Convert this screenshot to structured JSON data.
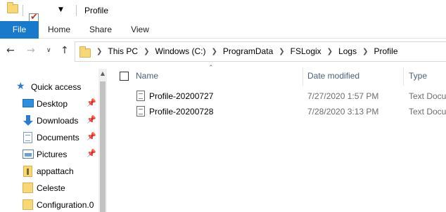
{
  "window": {
    "title": "Profile"
  },
  "ribbon": {
    "tabs": [
      "File",
      "Home",
      "Share",
      "View"
    ]
  },
  "address": {
    "crumbs": [
      "This PC",
      "Windows (C:)",
      "ProgramData",
      "FSLogix",
      "Logs",
      "Profile"
    ]
  },
  "nav_pane": {
    "quick_access_label": "Quick access",
    "items": [
      {
        "label": "Desktop",
        "icon": "desktop-icon",
        "pinned": true
      },
      {
        "label": "Downloads",
        "icon": "downloads-icon",
        "pinned": true
      },
      {
        "label": "Documents",
        "icon": "documents-icon",
        "pinned": true
      },
      {
        "label": "Pictures",
        "icon": "pictures-icon",
        "pinned": true
      },
      {
        "label": "appattach",
        "icon": "appattach-icon",
        "pinned": false
      },
      {
        "label": "Celeste",
        "icon": "folder-icon",
        "pinned": false
      },
      {
        "label": "Configuration.0",
        "icon": "folder-icon",
        "pinned": false
      }
    ]
  },
  "file_list": {
    "columns": {
      "name": "Name",
      "date": "Date modified",
      "type": "Type"
    },
    "rows": [
      {
        "name": "Profile-20200727",
        "date": "7/27/2020 1:57 PM",
        "type": "Text Docu"
      },
      {
        "name": "Profile-20200728",
        "date": "7/28/2020 3:13 PM",
        "type": "Text Docu"
      }
    ]
  },
  "colors": {
    "file_tab": "#1979ca",
    "folder": "#f8d775",
    "header_text": "#4c607a"
  }
}
